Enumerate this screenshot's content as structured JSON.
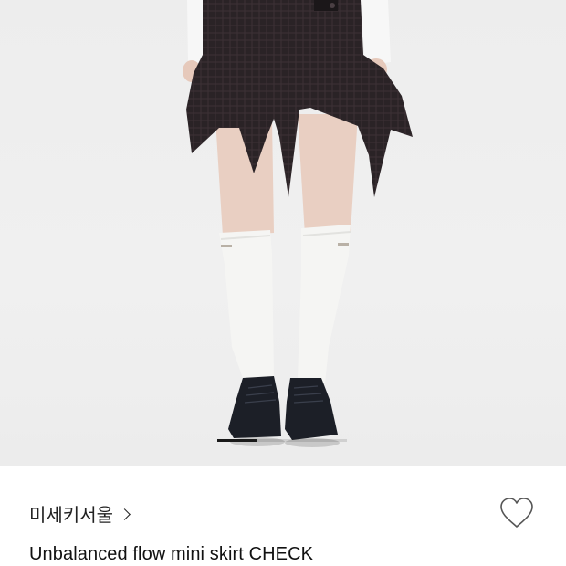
{
  "product": {
    "brand": "미세키서울",
    "title": "Unbalanced flow mini skirt CHECK",
    "image_alt": "Unbalanced flow mini skirt CHECK"
  },
  "carousel": {
    "progress": 0.3
  },
  "colors": {
    "skirt": "#2a2326",
    "shirt": "#f7f7f7",
    "socks": "#f5f5f3",
    "shoes": "#1c1f27",
    "skin": "#e9cfc2",
    "background": "#eeeeee"
  },
  "icons": {
    "wishlist": "heart-outline-icon",
    "brand_chevron": "chevron-right-icon"
  }
}
